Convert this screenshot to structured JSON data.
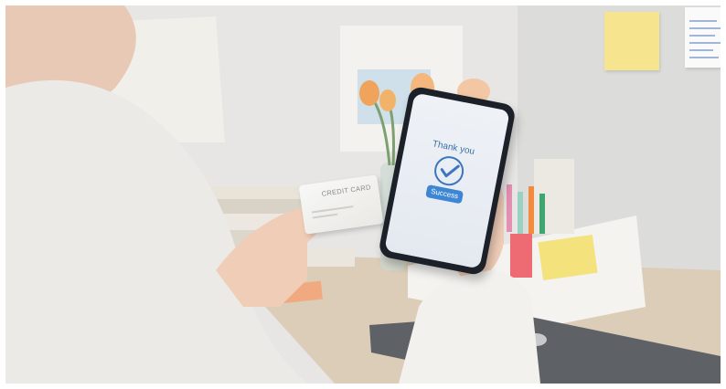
{
  "phone": {
    "message": "Thank you",
    "button_label": "Success",
    "accent_color": "#3d86d3",
    "icon": "checkmark-circle-icon"
  },
  "credit_card": {
    "label": "CREDIT CARD"
  },
  "colors": {
    "wall": "#e9e8e6",
    "desk": "#dccdb8",
    "sweater": "#eceae6",
    "sticky_note": "#f7e48f"
  }
}
